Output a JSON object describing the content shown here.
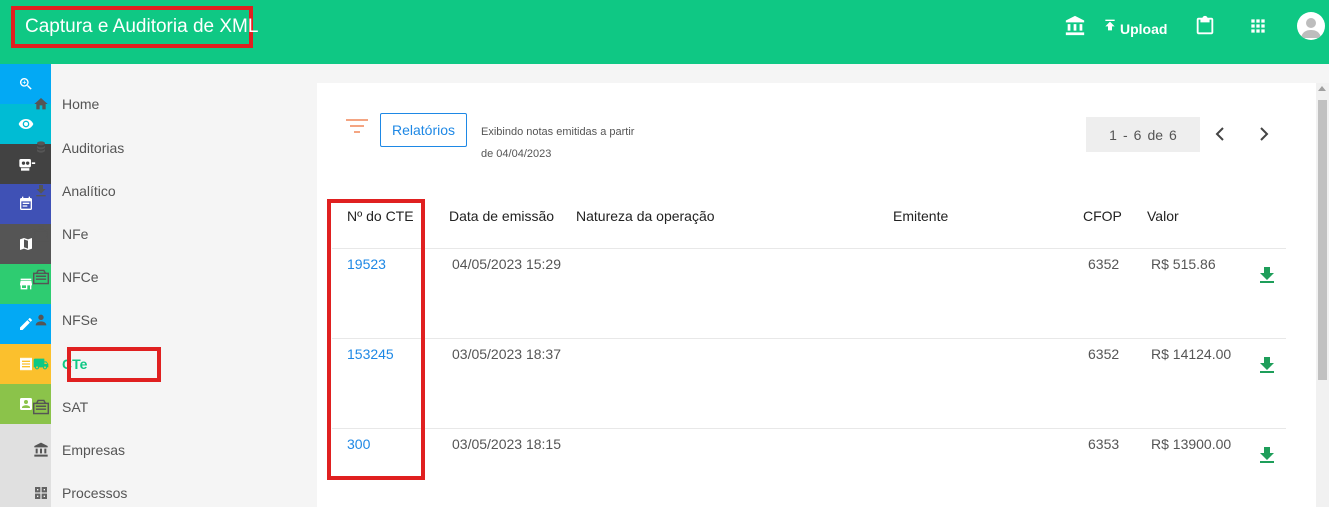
{
  "header": {
    "title": "Captura e Auditoria de XML",
    "upload_label": "Upload",
    "icons": [
      "bank-icon",
      "upload-icon",
      "clipboard-icon",
      "apps-grid-icon",
      "account-icon"
    ],
    "color": "#0fc884"
  },
  "rail": {
    "items": [
      {
        "icon": "zoom-icon",
        "color": "#03a9f4"
      },
      {
        "icon": "eye-icon",
        "color": "#00bcd4"
      },
      {
        "icon": "robot-icon",
        "color": "#424242"
      },
      {
        "icon": "calendar-icon",
        "color": "#3f51b5"
      },
      {
        "icon": "map-icon",
        "color": "#555555"
      },
      {
        "icon": "store-icon",
        "color": "#2ecc71"
      },
      {
        "icon": "pencil-icon",
        "color": "#03a9f4"
      },
      {
        "icon": "receipt-icon",
        "color": "#fbc02d"
      },
      {
        "icon": "contact-icon",
        "color": "#8bc34a"
      }
    ]
  },
  "sidebar": {
    "items": [
      {
        "label": "Home",
        "icon": "home-icon"
      },
      {
        "label": "Auditorias",
        "icon": "stack-icon"
      },
      {
        "label": "Analítico",
        "icon": "download-icon"
      },
      {
        "label": "NFe",
        "icon": "receipt-icon"
      },
      {
        "label": "NFCe",
        "icon": "receipt-icon"
      },
      {
        "label": "NFSe",
        "icon": "person-icon"
      },
      {
        "label": "CTe",
        "icon": "truck-icon",
        "active": true
      },
      {
        "label": "SAT",
        "icon": "receipt-icon"
      },
      {
        "label": "Empresas",
        "icon": "bank-icon"
      },
      {
        "label": "Processos",
        "icon": "process-icon"
      }
    ]
  },
  "toolbar": {
    "relatorios_label": "Relatórios",
    "info_line1": "Exibindo notas emitidas a partir",
    "info_line2": "de 04/04/2023"
  },
  "pager": {
    "from": "1",
    "dash": "-",
    "to": "6",
    "of_label": "de",
    "total": "6"
  },
  "table": {
    "headers": {
      "numero": "Nº do CTE",
      "data": "Data de emissão",
      "natureza": "Natureza da operação",
      "emitente": "Emitente",
      "cfop": "CFOP",
      "valor": "Valor"
    },
    "rows": [
      {
        "numero": "19523",
        "data": "04/05/2023 15:29",
        "cfop": "6352",
        "valor": "R$ 515.86"
      },
      {
        "numero": "153245",
        "data": "03/05/2023 18:37",
        "cfop": "6352",
        "valor": "R$ 14124.00"
      },
      {
        "numero": "300",
        "data": "03/05/2023 18:15",
        "cfop": "6353",
        "valor": "R$ 13900.00"
      }
    ]
  }
}
